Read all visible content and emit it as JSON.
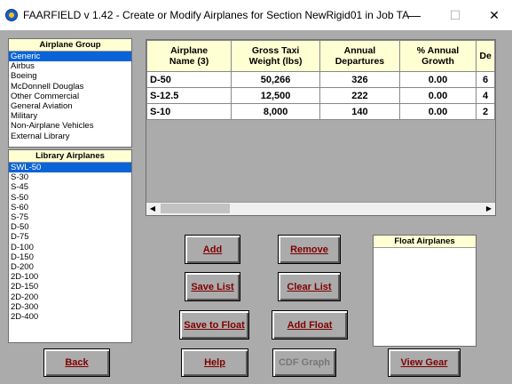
{
  "window": {
    "title": "FAARFIELD v 1.42 - Create or Modify Airplanes for Section NewRigid01 in Job TA",
    "minimize": "—",
    "maximize": "☐",
    "close": "✕"
  },
  "airplane_group": {
    "header": "Airplane Group",
    "items": [
      "Generic",
      "Airbus",
      "Boeing",
      "McDonnell Douglas",
      "Other Commercial",
      "General Aviation",
      "Military",
      "Non-Airplane Vehicles",
      "External Library"
    ],
    "selected": "Generic"
  },
  "library_airplanes": {
    "header": "Library Airplanes",
    "items": [
      "SWL-50",
      "S-30",
      "S-45",
      "S-50",
      "S-60",
      "S-75",
      "D-50",
      "D-75",
      "D-100",
      "D-150",
      "D-200",
      "2D-100",
      "2D-150",
      "2D-200",
      "2D-300",
      "2D-400"
    ],
    "selected": "SWL-50"
  },
  "grid": {
    "columns": [
      "Airplane\nName (3)",
      "Gross Taxi\nWeight (lbs)",
      "Annual\nDepartures",
      "% Annual\nGrowth",
      "De"
    ],
    "rows": [
      [
        "D-50",
        "50,266",
        "326",
        "0.00",
        "6"
      ],
      [
        "S-12.5",
        "12,500",
        "222",
        "0.00",
        "4"
      ],
      [
        "S-10",
        "8,000",
        "140",
        "0.00",
        "2"
      ]
    ]
  },
  "float_airplanes": {
    "header": "Float Airplanes"
  },
  "buttons": {
    "add": "Add",
    "remove": "Remove",
    "save_list": "Save List",
    "clear_list": "Clear List",
    "save_to_float": "Save to Float",
    "add_float": "Add Float",
    "back": "Back",
    "help": "Help",
    "cdf_graph": "CDF Graph",
    "view_gear": "View Gear"
  }
}
